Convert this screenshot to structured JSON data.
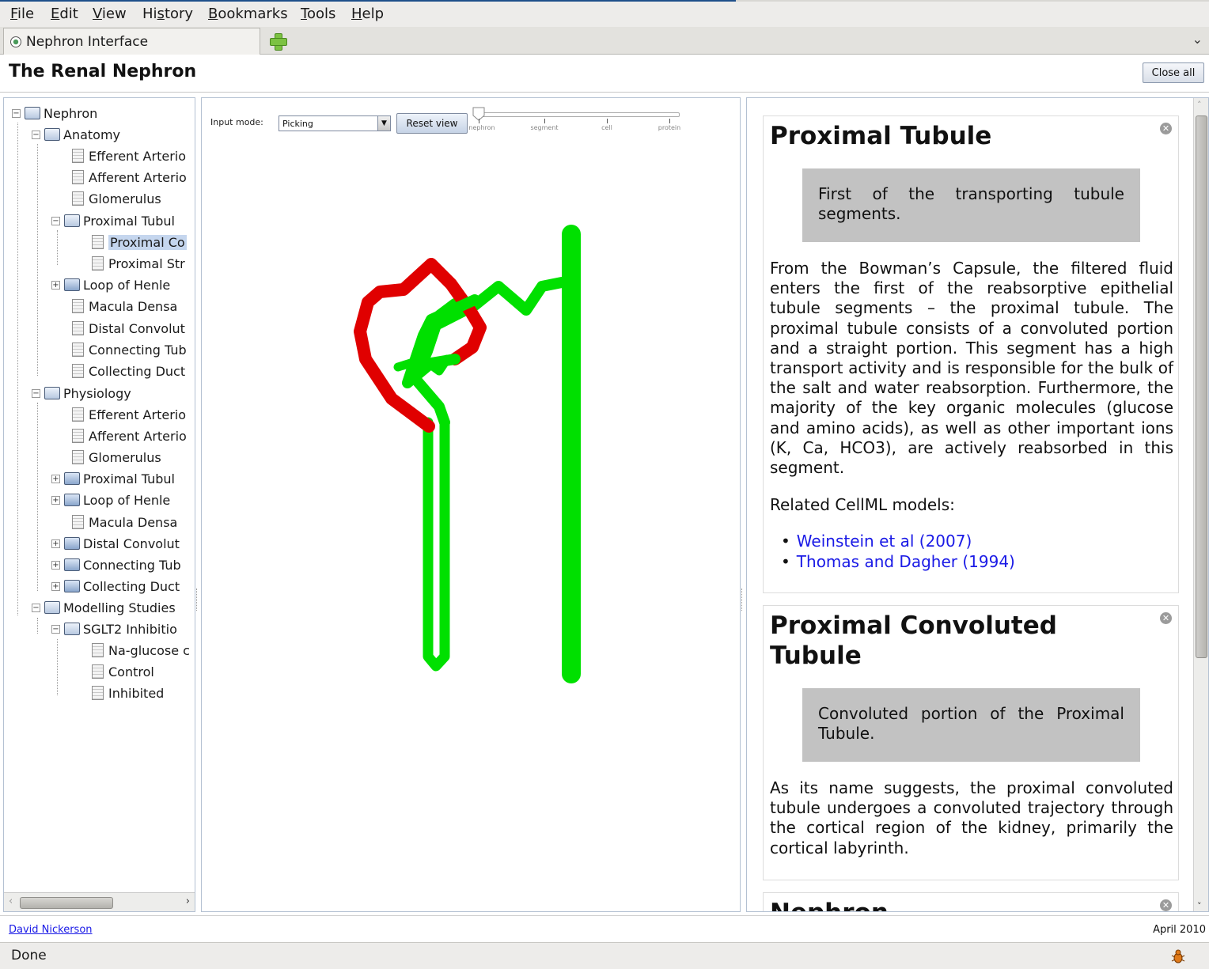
{
  "menu": [
    {
      "label": "File",
      "key": "F",
      "rest": "ile"
    },
    {
      "label": "Edit",
      "key": "E",
      "rest": "dit"
    },
    {
      "label": "View",
      "key": "V",
      "rest": "iew"
    },
    {
      "label": "History",
      "key": "s",
      "pre": "Hi",
      "rest": "tory"
    },
    {
      "label": "Bookmarks",
      "key": "B",
      "rest": "ookmarks"
    },
    {
      "label": "Tools",
      "key": "T",
      "rest": "ools"
    },
    {
      "label": "Help",
      "key": "H",
      "rest": "elp"
    }
  ],
  "tab": {
    "title": "Nephron Interface",
    "icon": "page-favicon-icon",
    "new_tab_icon": "plus-icon",
    "list_icon": "chevron-down-icon"
  },
  "page": {
    "title": "The Renal Nephron",
    "close_all": "Close all"
  },
  "tree": {
    "root": "Nephron",
    "anatomy": {
      "label": "Anatomy",
      "items": [
        "Efferent Arterio",
        "Afferent Arterio",
        "Glomerulus"
      ],
      "proximal": {
        "label": "Proximal Tubul",
        "children": [
          "Proximal Co",
          "Proximal Str"
        ],
        "selected": "Proximal Co"
      },
      "items2": [
        "Loop of Henle",
        "Macula Densa",
        "Distal Convolut",
        "Connecting Tub",
        "Collecting Duct"
      ]
    },
    "physiology": {
      "label": "Physiology",
      "items": [
        "Efferent Arterio",
        "Afferent Arterio",
        "Glomerulus",
        "Proximal Tubul",
        "Loop of Henle",
        "Macula Densa",
        "Distal Convolut",
        "Connecting Tub",
        "Collecting Duct"
      ]
    },
    "modelling": {
      "label": "Modelling Studies",
      "sglt2": {
        "label": "SGLT2 Inhibitio",
        "children": [
          "Na-glucose c",
          "Control",
          "Inhibited"
        ]
      }
    }
  },
  "viewer": {
    "input_mode_label": "Input mode:",
    "input_mode_value": "Picking",
    "reset_view": "Reset view",
    "zoom_levels": [
      "nephron",
      "segment",
      "cell",
      "protein"
    ],
    "zoom_selected": "nephron",
    "colors": {
      "tubule": "#00e600",
      "highlight": "#e60000"
    }
  },
  "cards": [
    {
      "title": "Proximal Tubule",
      "summary": "First of the transporting tubule segments.",
      "body": "From the Bowman’s Capsule, the filtered fluid enters the first of the reabsorptive epithelial tubule segments – the proximal tubule. The proximal tubule consists of a convoluted portion and a straight portion. This segment has a high transport activity and is responsible for the bulk of the salt and water reabsorption. Furthermore, the majority of the key organic molecules (glucose and amino acids), as well as other important ions (K, Ca, HCO3), are actively reabsorbed in this segment.",
      "related_label": "Related CellML models:",
      "links": [
        "Weinstein et al (2007)",
        "Thomas and Dagher (1994)"
      ]
    },
    {
      "title_line1": "Proximal Convoluted",
      "title_line2": "Tubule",
      "summary": "Convoluted portion of the Proximal Tubule.",
      "body": "As its name suggests, the proximal convoluted tubule undergoes a convoluted trajectory through the cortical region of the kidney, primarily the cortical labyrinth."
    },
    {
      "title": "Nephron"
    }
  ],
  "footer": {
    "author": "David Nickerson",
    "date": "April 2010"
  },
  "status": {
    "text": "Done"
  }
}
